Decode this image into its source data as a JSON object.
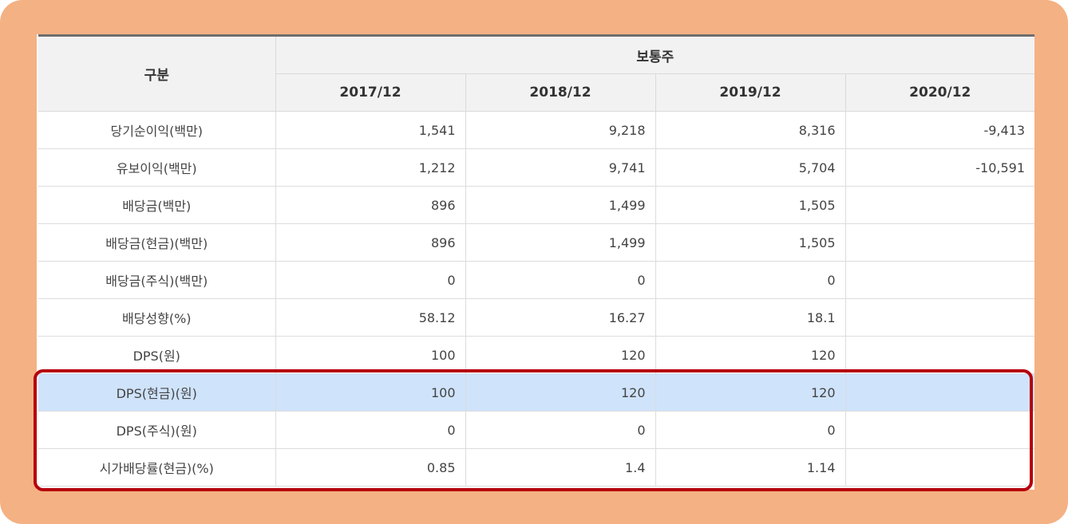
{
  "table": {
    "header_label": "구분",
    "group_header": "보통주",
    "columns": [
      "2017/12",
      "2018/12",
      "2019/12",
      "2020/12"
    ],
    "rows": [
      {
        "label": "당기순이익(백만)",
        "values": [
          "1,541",
          "9,218",
          "8,316",
          "-9,413"
        ]
      },
      {
        "label": "유보이익(백만)",
        "values": [
          "1,212",
          "9,741",
          "5,704",
          "-10,591"
        ]
      },
      {
        "label": "배당금(백만)",
        "values": [
          "896",
          "1,499",
          "1,505",
          ""
        ]
      },
      {
        "label": "배당금(현금)(백만)",
        "values": [
          "896",
          "1,499",
          "1,505",
          ""
        ]
      },
      {
        "label": "배당금(주식)(백만)",
        "values": [
          "0",
          "0",
          "0",
          ""
        ]
      },
      {
        "label": "배당성향(%)",
        "values": [
          "58.12",
          "16.27",
          "18.1",
          ""
        ]
      },
      {
        "label": "DPS(원)",
        "values": [
          "100",
          "120",
          "120",
          ""
        ]
      },
      {
        "label": "DPS(현금)(원)",
        "values": [
          "100",
          "120",
          "120",
          ""
        ]
      },
      {
        "label": "DPS(주식)(원)",
        "values": [
          "0",
          "0",
          "0",
          ""
        ]
      },
      {
        "label": "시가배당률(현금)(%)",
        "values": [
          "0.85",
          "1.4",
          "1.14",
          ""
        ]
      }
    ],
    "highlighted_row_index": 7
  },
  "colors": {
    "frame_background": "#f4b183",
    "highlight_row": "#cfe3fb",
    "highlight_border": "#b5000d",
    "header_background": "#f2f2f2"
  }
}
